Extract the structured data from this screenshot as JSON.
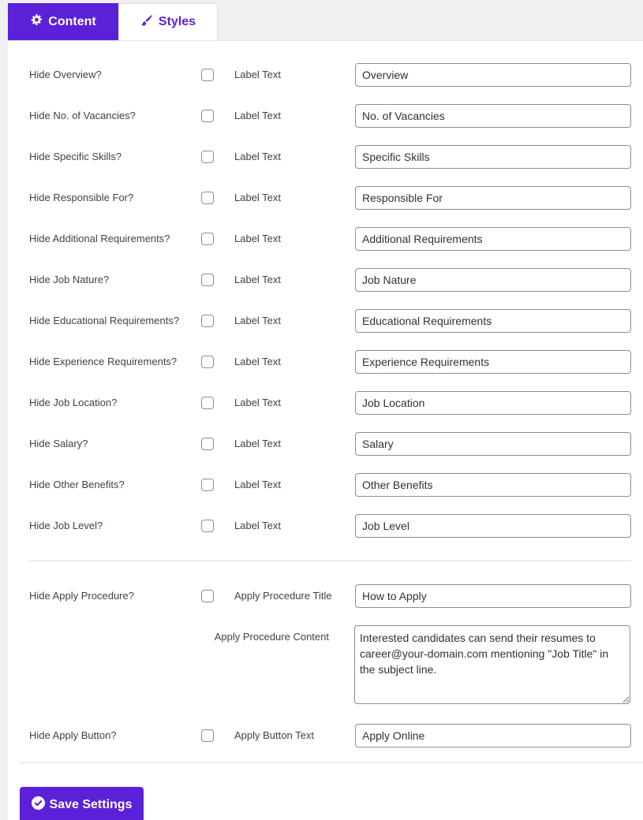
{
  "tabs": [
    {
      "label": "Content",
      "icon": "gear-icon",
      "active": true
    },
    {
      "label": "Styles",
      "icon": "paintbrush-icon",
      "active": false
    }
  ],
  "colors": {
    "accent": "#5b21d9"
  },
  "fields": [
    {
      "hide_label": "Hide Overview?",
      "checked": false,
      "sub_label": "Label Text",
      "value": "Overview"
    },
    {
      "hide_label": "Hide No. of Vacancies?",
      "checked": false,
      "sub_label": "Label Text",
      "value": "No. of Vacancies"
    },
    {
      "hide_label": "Hide Specific Skills?",
      "checked": false,
      "sub_label": "Label Text",
      "value": "Specific Skills"
    },
    {
      "hide_label": "Hide Responsible For?",
      "checked": false,
      "sub_label": "Label Text",
      "value": "Responsible For"
    },
    {
      "hide_label": "Hide Additional Requirements?",
      "checked": false,
      "sub_label": "Label Text",
      "value": "Additional Requirements"
    },
    {
      "hide_label": "Hide Job Nature?",
      "checked": false,
      "sub_label": "Label Text",
      "value": "Job Nature"
    },
    {
      "hide_label": "Hide Educational Requirements?",
      "checked": false,
      "sub_label": "Label Text",
      "value": "Educational Requirements"
    },
    {
      "hide_label": "Hide Experience Requirements?",
      "checked": false,
      "sub_label": "Label Text",
      "value": "Experience Requirements"
    },
    {
      "hide_label": "Hide Job Location?",
      "checked": false,
      "sub_label": "Label Text",
      "value": "Job Location"
    },
    {
      "hide_label": "Hide Salary?",
      "checked": false,
      "sub_label": "Label Text",
      "value": "Salary"
    },
    {
      "hide_label": "Hide Other Benefits?",
      "checked": false,
      "sub_label": "Label Text",
      "value": "Other Benefits"
    },
    {
      "hide_label": "Hide Job Level?",
      "checked": false,
      "sub_label": "Label Text",
      "value": "Job Level"
    }
  ],
  "apply_procedure": {
    "hide_label": "Hide Apply Procedure?",
    "checked": false,
    "title_label": "Apply Procedure Title",
    "title_value": "How to Apply",
    "content_label": "Apply Procedure Content",
    "content_value": "Interested candidates can send their resumes to career@your-domain.com mentioning \"Job Title\" in the subject line."
  },
  "apply_button": {
    "hide_label": "Hide Apply Button?",
    "checked": false,
    "text_label": "Apply Button Text",
    "text_value": "Apply Online"
  },
  "save_button": {
    "label": "Save Settings",
    "icon": "check-circle-icon"
  }
}
